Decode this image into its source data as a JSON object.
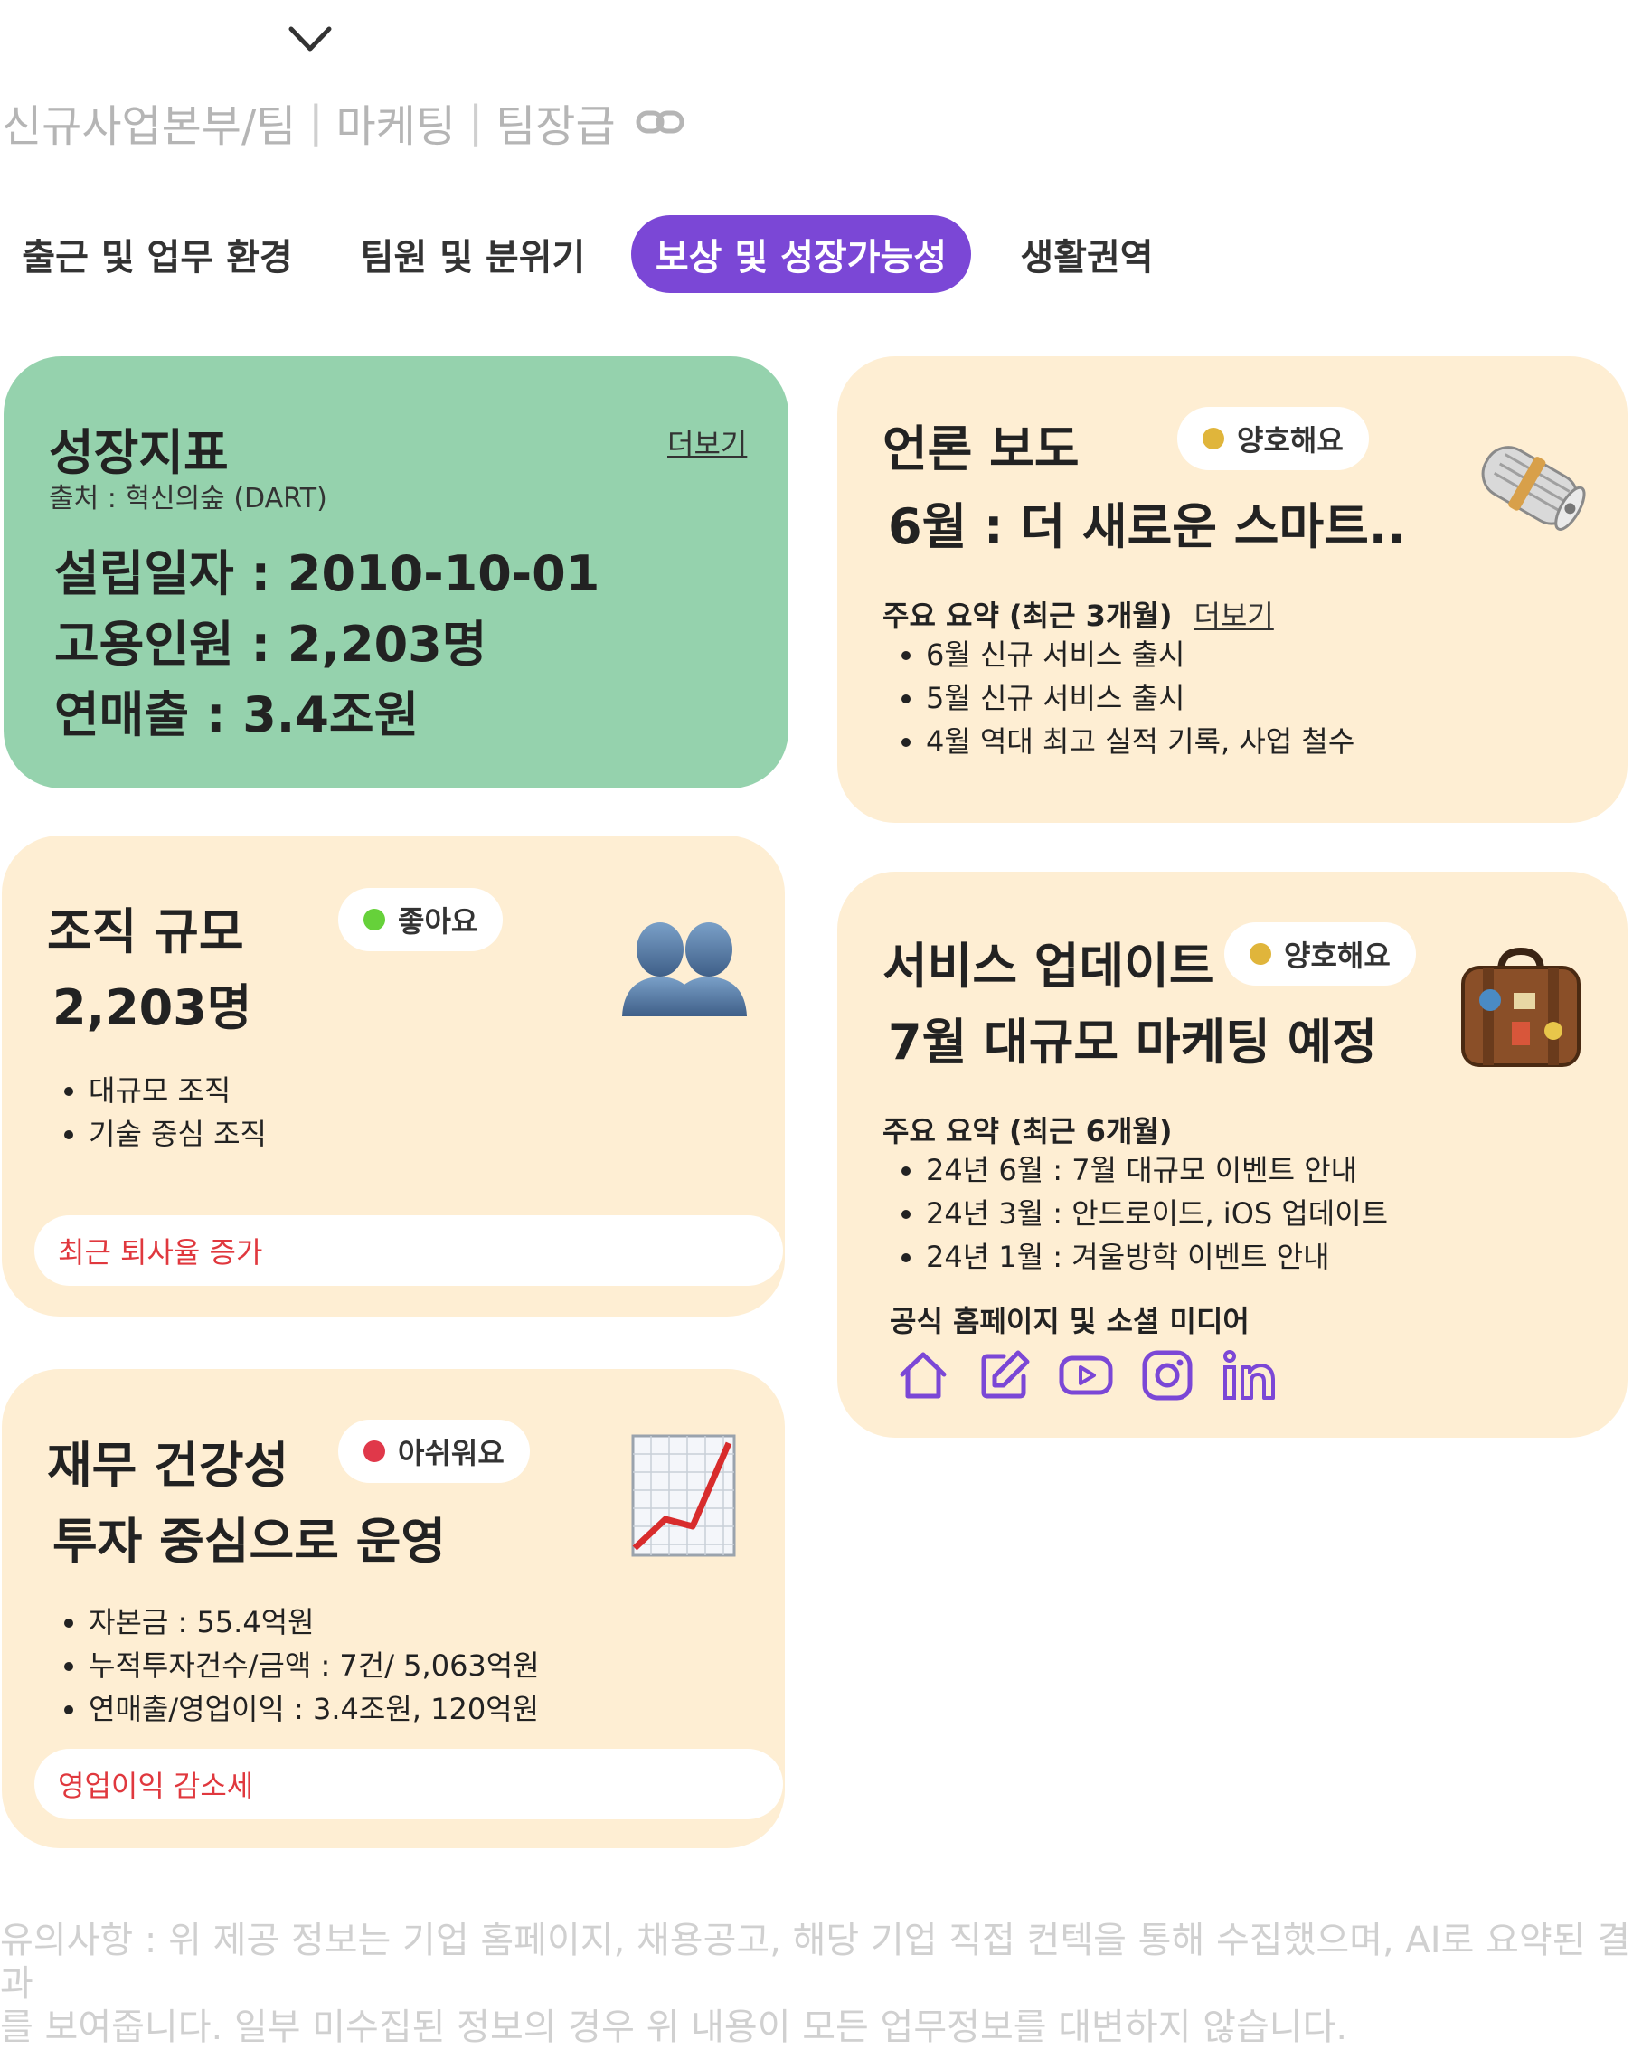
{
  "breadcrumb": {
    "dept": "신규사업본부/팀",
    "job": "마케팅",
    "level": "팀장급"
  },
  "tabs": [
    {
      "label": "출근 및 업무 환경"
    },
    {
      "label": "팀원 및 분위기"
    },
    {
      "label": "보상 및 성장가능성"
    },
    {
      "label": "생활권역"
    }
  ],
  "active_tab": "보상 및 성장가능성",
  "growth": {
    "title": "성장지표",
    "more": "더보기",
    "source": "출처 : 혁신의숲 (DART)",
    "founded": "설립일자 : 2010-10-01",
    "employees": "고용인원 : 2,203명",
    "revenue": "연매출 : 3.4조원"
  },
  "press": {
    "title": "언론 보도",
    "badge": "양호해요",
    "badge_color": "#e0b53b",
    "headline": "6월 : 더 새로운 스마트..",
    "summary_label": "주요 요약 (최근 3개월)",
    "more": "더보기",
    "items": [
      "6월 신규 서비스 출시",
      "5월 신규 서비스 출시",
      "4월 역대 최고 실적 기록, 사업 철수"
    ]
  },
  "org": {
    "title": "조직 규모",
    "badge": "좋아요",
    "badge_color": "#66d13a",
    "headcount": "2,203명",
    "items": [
      "대규모 조직",
      "기술 중심 조직"
    ],
    "alert": "최근 퇴사율 증가"
  },
  "service": {
    "title": "서비스 업데이트",
    "badge": "양호해요",
    "badge_color": "#e0b53b",
    "headline": "7월 대규모 마케팅 예정",
    "summary_label": "주요 요약 (최근 6개월)",
    "items": [
      "24년 6월 : 7월 대규모 이벤트 안내",
      "24년 3월 : 안드로이드, iOS 업데이트",
      "24년 1월 : 겨울방학 이벤트 안내"
    ],
    "social_label": "공식 홈페이지 및 소셜 미디어",
    "social_icons": [
      "home-icon",
      "blog-edit-icon",
      "youtube-icon",
      "instagram-icon",
      "linkedin-icon"
    ],
    "social_color": "#7b47d6"
  },
  "finance": {
    "title": "재무 건강성",
    "badge": "아쉬워요",
    "badge_color": "#e0384a",
    "headline": "투자 중심으로 운영",
    "items": [
      "자본금  : 55.4억원",
      "누적투자건수/금액 : 7건/ 5,063억원",
      "연매출/영업이익 : 3.4조원, 120억원"
    ],
    "alert": "영업이익 감소세"
  },
  "footer": {
    "line1": "유의사항 : 위 제공 정보는 기업 홈페이지, 채용공고, 해당 기업 직접 컨텍을 통해 수집했으며, AI로 요약된 결과",
    "line2": "를 보여줍니다. 일부 미수집된 정보의 경우 위 내용이 모든 업무정보를 대변하지 않습니다."
  },
  "accent": "#7b47d6"
}
